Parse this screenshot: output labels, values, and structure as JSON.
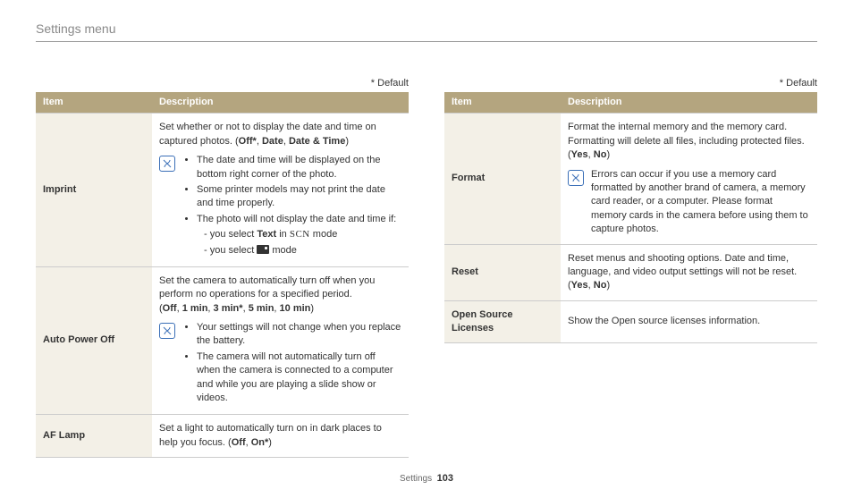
{
  "header": {
    "title": "Settings menu"
  },
  "default_marker": "* Default",
  "table_headers": {
    "item": "Item",
    "description": "Description"
  },
  "left": {
    "imprint": {
      "name": "Imprint",
      "intro": "Set whether or not to display the date and time on captured photos. (",
      "options": [
        "Off*",
        "Date",
        "Date & Time"
      ],
      "note": {
        "b1": "The date and time will be displayed on the bottom right corner of the photo.",
        "b2": "Some printer models may not print the date and time properly.",
        "b3_lead": "The photo will not display the date and time if:",
        "b3_d1a": "you select ",
        "b3_d1b": "Text",
        "b3_d1c": " in ",
        "b3_d1d": " mode",
        "b3_d2a": "you select ",
        "b3_d2b": " mode"
      }
    },
    "autopoweroff": {
      "name": "Auto Power Off",
      "intro": "Set the camera to automatically turn off when you perform no operations for a specified period.",
      "options": [
        "Off",
        "1 min",
        "3 min*",
        "5 min",
        "10 min"
      ],
      "note": {
        "b1": "Your settings will not change when you replace the battery.",
        "b2": "The camera will not automatically turn off when the camera is connected to a computer and while you are playing a slide show or videos."
      }
    },
    "aflamp": {
      "name": "AF Lamp",
      "desc_a": "Set a light to automatically turn on in dark places to help you focus. (",
      "opt1": "Off",
      "opt2": "On*",
      "desc_b": ")"
    }
  },
  "right": {
    "format": {
      "name": "Format",
      "intro": "Format the internal memory and the memory card. Formatting will delete all files, including protected files. (",
      "opt1": "Yes",
      "opt2": "No",
      "note": "Errors can occur if you use a memory card formatted by another brand of camera, a memory card reader, or a computer. Please format memory cards in the camera before using them to capture photos."
    },
    "reset": {
      "name": "Reset",
      "desc": "Reset menus and shooting options. Date and time, language, and video output settings will not be reset. (",
      "opt1": "Yes",
      "opt2": "No"
    },
    "osl": {
      "name": "Open Source Licenses",
      "desc": "Show the Open source licenses information."
    }
  },
  "footer": {
    "section": "Settings",
    "page": "103"
  }
}
